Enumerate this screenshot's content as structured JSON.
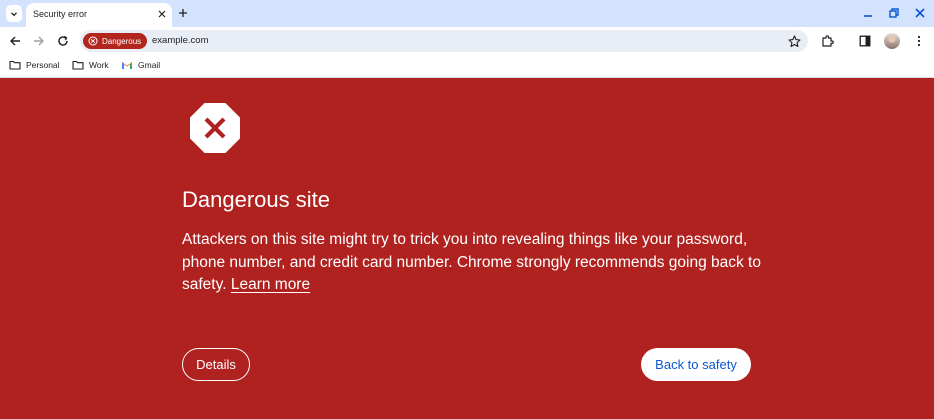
{
  "tab": {
    "title": "Security error",
    "active": true
  },
  "toolbar": {
    "security_chip_label": "Dangerous",
    "url": "example.com"
  },
  "bookmarks": [
    {
      "label": "Personal",
      "icon": "folder-icon"
    },
    {
      "label": "Work",
      "icon": "folder-icon"
    },
    {
      "label": "Gmail",
      "icon": "gmail-icon"
    }
  ],
  "interstitial": {
    "title": "Dangerous site",
    "body": "Attackers on this site might try to trick you into revealing things like your password, phone number, and credit card number. Chrome strongly recommends going back to safety.",
    "learn_more": "Learn more",
    "details_button": "Details",
    "back_button": "Back to safety",
    "icon": "danger-stop-icon"
  },
  "colors": {
    "page_background": "#b0221f",
    "tabstrip": "#d3e3fd",
    "omnibox": "#e9eef6",
    "danger_chip": "#b3261e",
    "back_button_text": "#0b57d0"
  }
}
